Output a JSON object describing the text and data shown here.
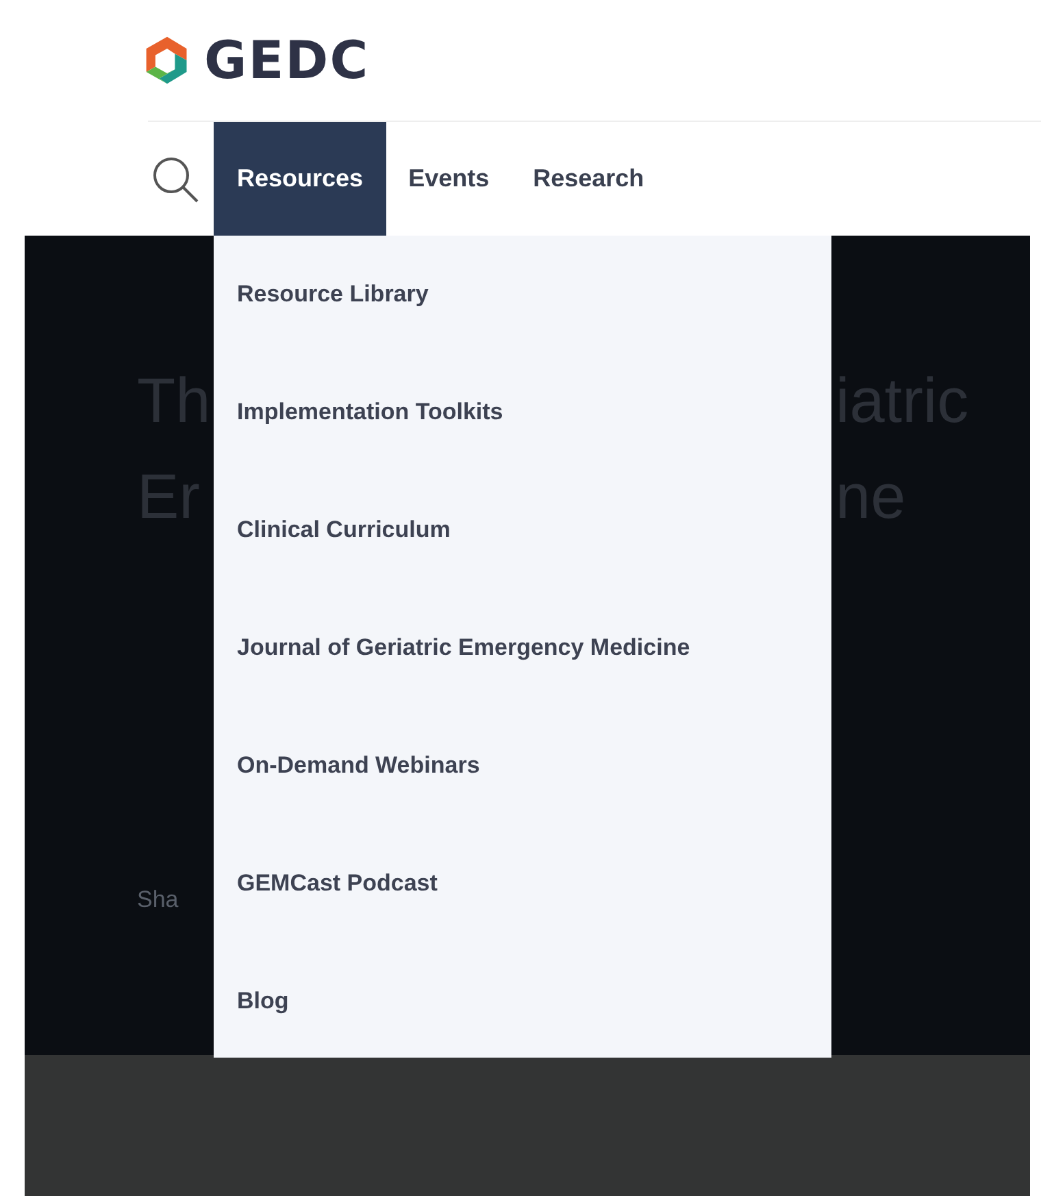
{
  "logo": {
    "text": "GEDC"
  },
  "nav": {
    "tabs": [
      {
        "label": "Resources",
        "selected": true
      },
      {
        "label": "Events",
        "selected": false
      },
      {
        "label": "Research",
        "selected": false
      }
    ]
  },
  "dropdown": {
    "items": [
      "Resource Library",
      "Implementation Toolkits",
      "Clinical Curriculum",
      "Journal of Geriatric Emergency Medicine",
      "On-Demand Webinars",
      "GEMCast Podcast",
      "Blog"
    ]
  },
  "hero": {
    "left_fragments": [
      "Th",
      "Er"
    ],
    "right_fragments": [
      "iatric",
      "ne"
    ],
    "share_fragment": "Sha"
  }
}
